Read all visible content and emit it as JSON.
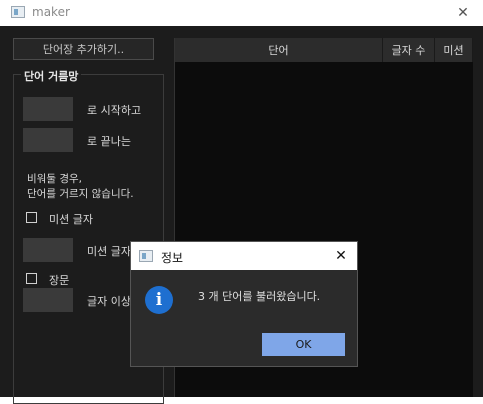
{
  "window": {
    "title": "maker",
    "close_glyph": "✕"
  },
  "toolbar": {
    "add_wordlist_label": "단어장 추가하기.."
  },
  "filter": {
    "group_title": "단어 거름망",
    "starts_with_label": "로 시작하고",
    "ends_with_label": "로 끝나는",
    "note_line1": "비워둘 경우,",
    "note_line2": "단어를 거르지 않습니다.",
    "mission_filter_label": "미션 글자",
    "mission_letter_label": "미션 글자",
    "long_word_label": "장문",
    "length_label": "글자 이상"
  },
  "table": {
    "columns": [
      "단어",
      "글자 수",
      "미션"
    ]
  },
  "dialog": {
    "title": "정보",
    "close_glyph": "✕",
    "icon_glyph": "i",
    "message": "3 개 단어를 불러왔습니다.",
    "ok_label": "OK"
  },
  "icons": {
    "app": "app-window-icon",
    "info": "info-icon",
    "close": "close-icon"
  },
  "colors": {
    "background": "#1c1c1c",
    "field": "#3a3a3a",
    "accent": "#7fa6e8",
    "info": "#1e6fd0"
  }
}
